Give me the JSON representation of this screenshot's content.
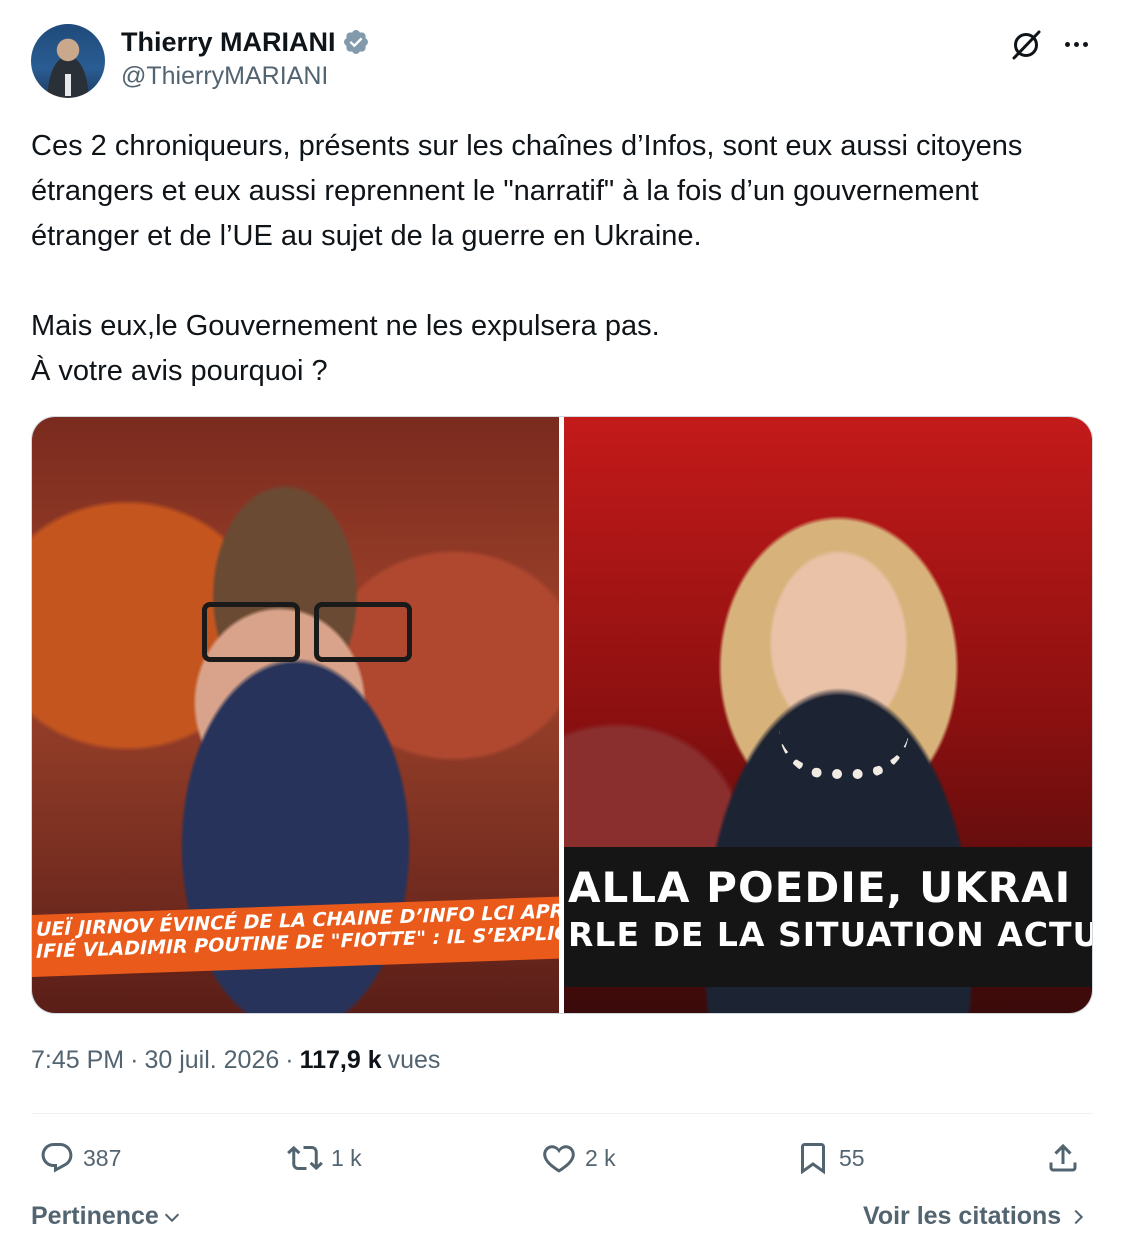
{
  "author": {
    "display_name": "Thierry MARIANI",
    "handle": "@ThierryMARIANI",
    "verified": true,
    "verified_color": "#829aab"
  },
  "tweet": {
    "paragraphs": [
      "Ces 2 chroniqueurs, présents sur les chaînes d’Infos, sont eux aussi citoyens étrangers et eux aussi reprennent le \"narratif\" à la fois d’un gouvernement étranger et de l’UE au sujet de la guerre en Ukraine.",
      "Mais eux,le Gouvernement ne les expulsera pas.\nÀ votre avis pourquoi ?"
    ]
  },
  "media": {
    "left_banner": {
      "line1": "UEÏ JIRNOV ÉVINCÉ DE LA CHAINE D’INFO LCI APR",
      "line2": "IFIÉ VLADIMIR POUTINE DE \"FIOTTE\" : IL S’EXPLIQ"
    },
    "right_banner": {
      "line1": "ALLA POEDIE, UKRAI",
      "line2": "RLE DE LA SITUATION ACTUEL"
    }
  },
  "meta": {
    "time": "7:45 PM",
    "sep1": "·",
    "date": "30 juil. 2026",
    "sep2": "·",
    "views_count": "117,9 k",
    "views_label": "vues"
  },
  "actions": {
    "reply_count": "387",
    "repost_count": "1 k",
    "like_count": "2 k",
    "bookmark_count": "55"
  },
  "footer": {
    "sort_label": "Pertinence",
    "quotes_label": "Voir les citations"
  },
  "colors": {
    "text_primary": "#0f1419",
    "text_secondary": "#536471",
    "divider": "#eff3f4"
  },
  "icons": [
    "verified-badge-icon",
    "grok-icon",
    "more-icon",
    "reply-icon",
    "repost-icon",
    "like-icon",
    "bookmark-icon",
    "share-icon",
    "chevron-down-icon",
    "chevron-right-icon"
  ]
}
